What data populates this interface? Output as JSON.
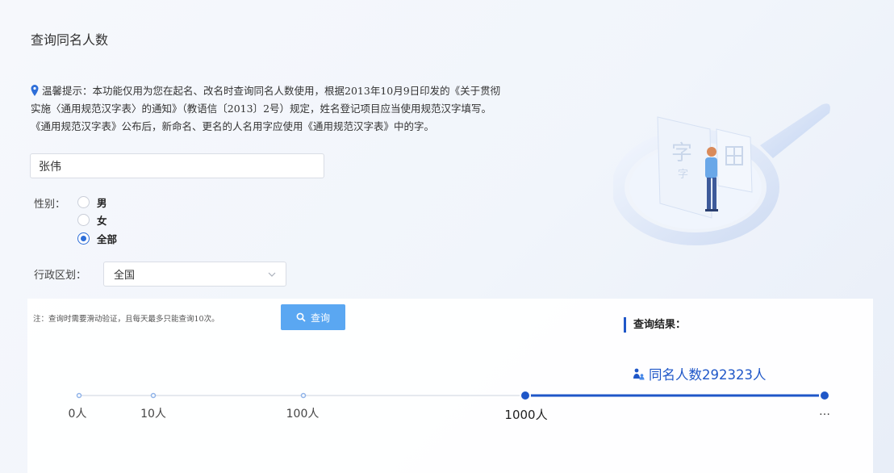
{
  "page": {
    "title": "查询同名人数"
  },
  "notice": {
    "icon": "pin-icon",
    "lines": [
      "温馨提示：本功能仅用为您在起名、改名时查询同名人数使用，根据2013年10月9日印发的《关于贯彻",
      "实施〈通用规范汉字表〉的通知》（教语信〔2013〕2号）规定，姓名登记项目应当使用规范汉字填写。",
      "《通用规范汉字表》公布后，新命名、更名的人名用字应使用《通用规范汉字表》中的字。"
    ]
  },
  "form": {
    "name_value": "张伟",
    "gender_label": "性别：",
    "gender_options": [
      {
        "label": "男",
        "checked": false
      },
      {
        "label": "女",
        "checked": false
      },
      {
        "label": "全部",
        "checked": true
      }
    ],
    "region_label": "行政区划：",
    "region_value": "全国"
  },
  "note": "注：查询时需要滑动验证，且每天最多只能查询10次。",
  "query_button": {
    "label": "查询",
    "icon": "search-icon"
  },
  "result": {
    "heading": "查询结果：",
    "count_text": "同名人数292323人",
    "icon": "person-icon",
    "value": 292323
  },
  "scale": {
    "labels": [
      "0人",
      "10人",
      "100人",
      "1000人",
      "…"
    ],
    "active_from_index": 3
  },
  "colors": {
    "accent": "#1f57c8",
    "button": "#5aa7f2",
    "radio": "#2d6ed8"
  }
}
